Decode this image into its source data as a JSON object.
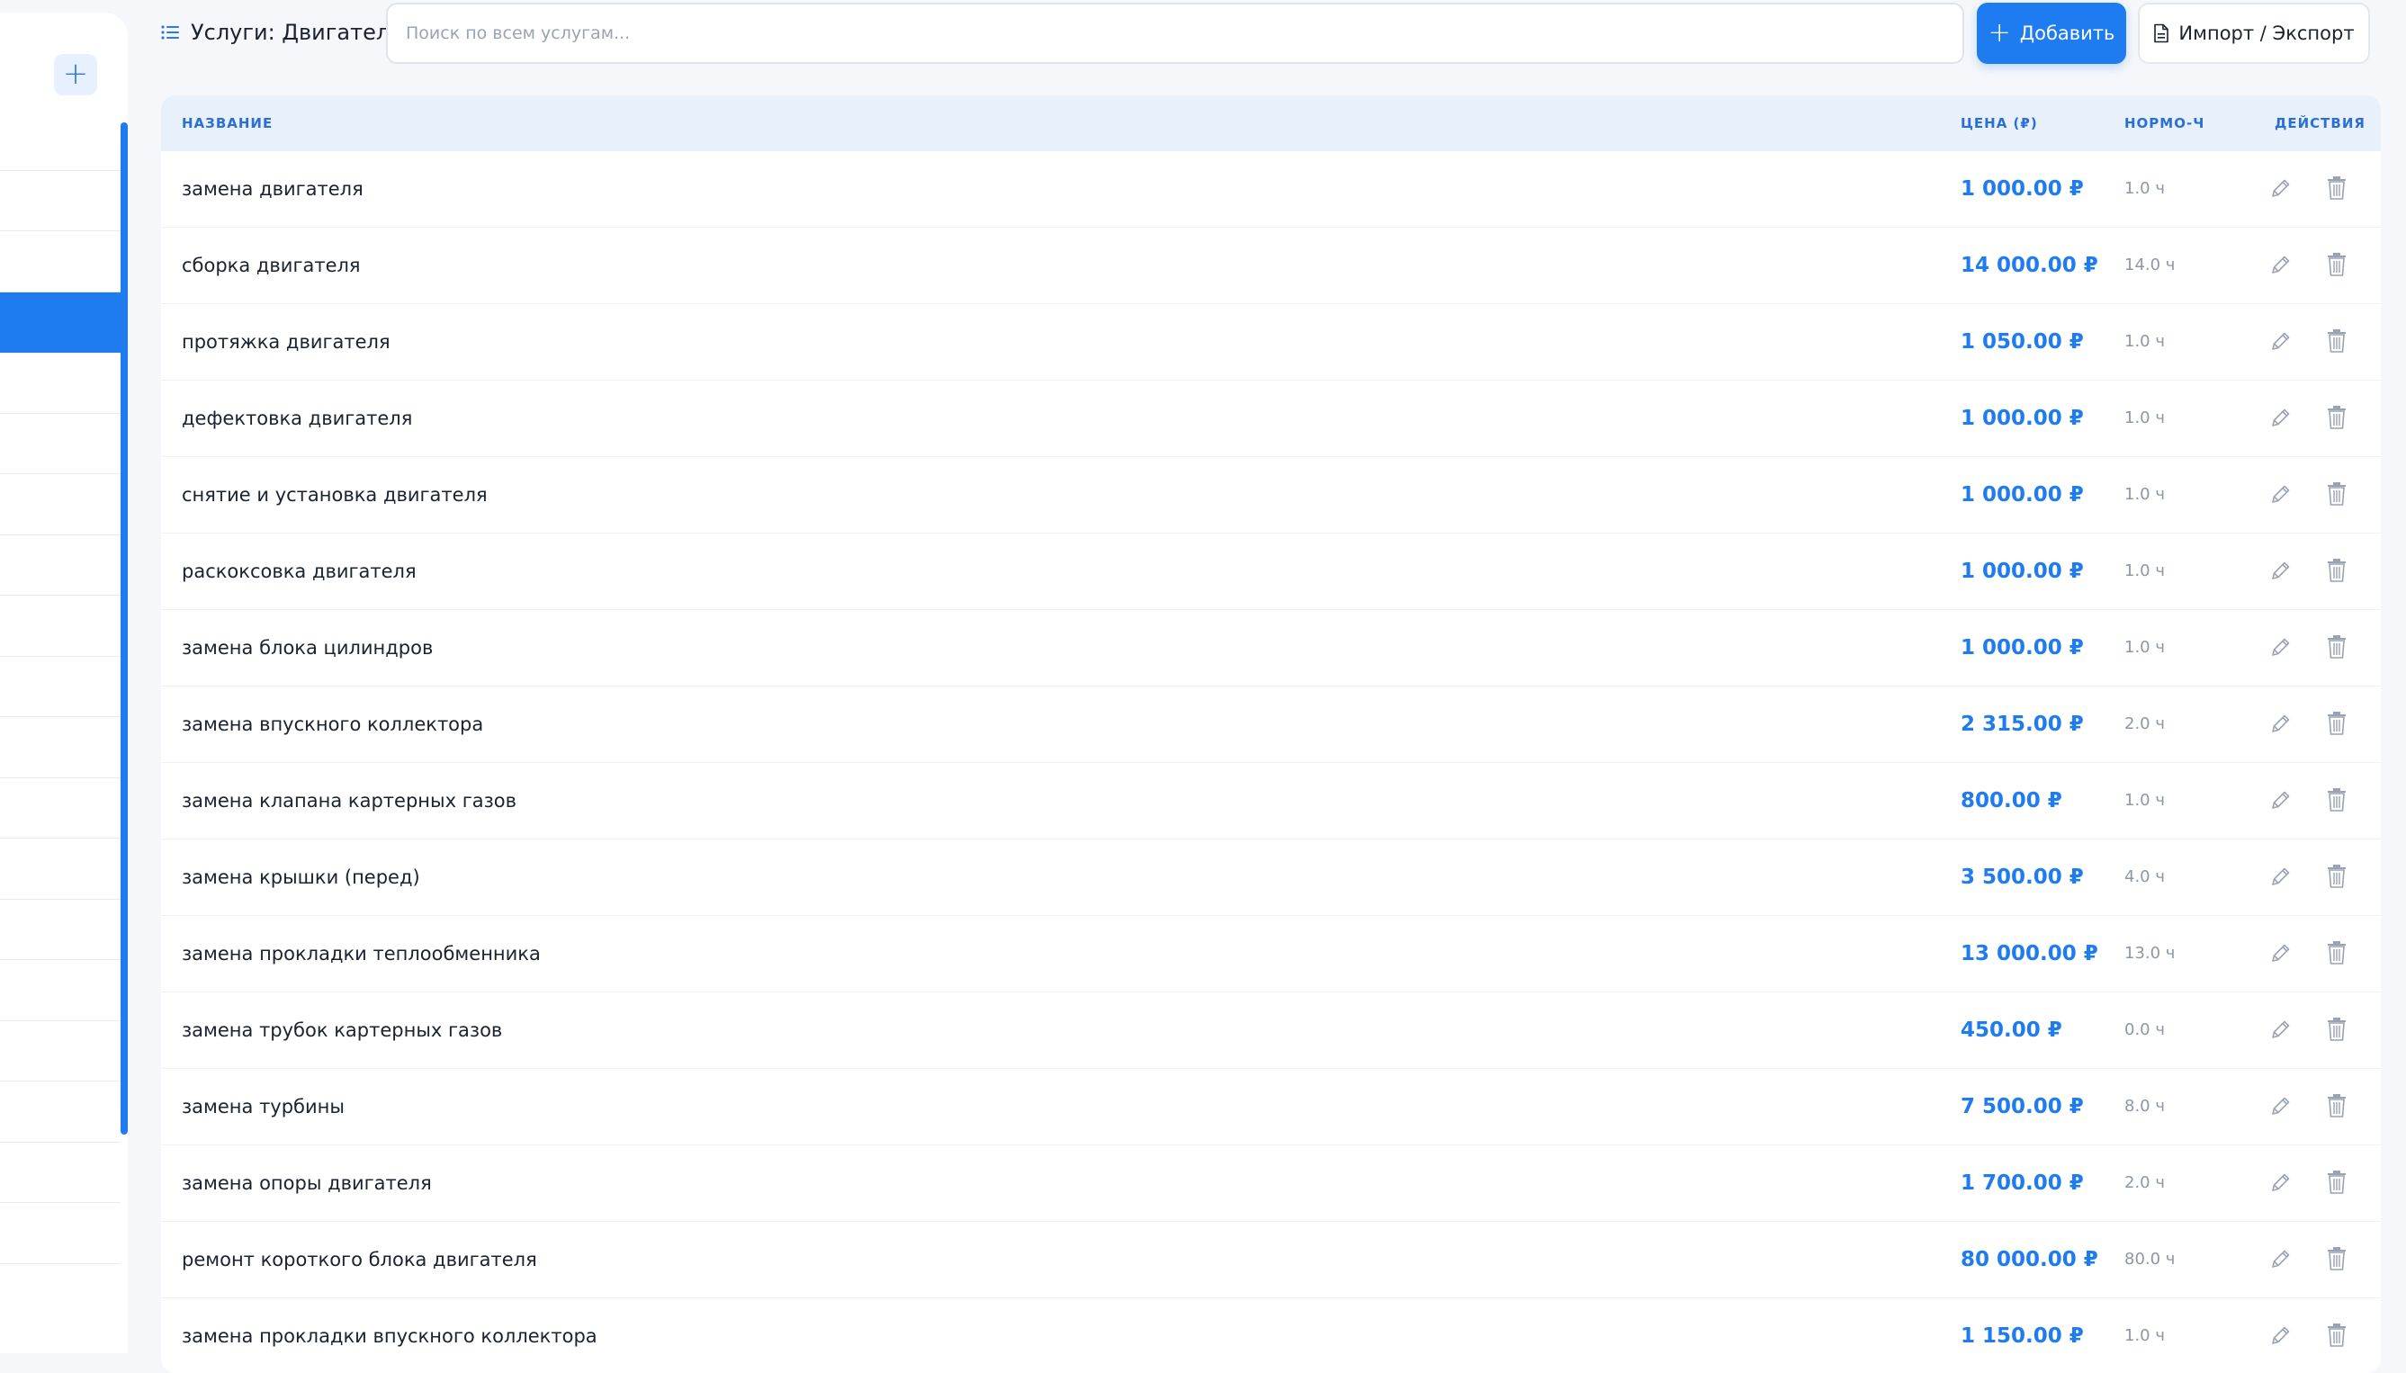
{
  "header": {
    "title": "Услуги: Двигатель",
    "search_placeholder": "Поиск по всем услугам...",
    "add_label": "Добавить",
    "import_label": "Импорт / Экспорт"
  },
  "sidebar": {
    "add_symbol": "+",
    "item_count": 19,
    "active_index": 3
  },
  "table": {
    "columns": {
      "name": "НАЗВАНИЕ",
      "price": "ЦЕНА (₽)",
      "hours": "НОРМО-Ч",
      "actions": "ДЕЙСТВИЯ"
    },
    "rows": [
      {
        "name": "замена двигателя",
        "price": "1 000.00 ₽",
        "hours": "1.0 ч"
      },
      {
        "name": "сборка двигателя",
        "price": "14 000.00 ₽",
        "hours": "14.0 ч"
      },
      {
        "name": "протяжка двигателя",
        "price": "1 050.00 ₽",
        "hours": "1.0 ч"
      },
      {
        "name": "дефектовка двигателя",
        "price": "1 000.00 ₽",
        "hours": "1.0 ч"
      },
      {
        "name": "снятие и установка двигателя",
        "price": "1 000.00 ₽",
        "hours": "1.0 ч"
      },
      {
        "name": "раскоксовка двигателя",
        "price": "1 000.00 ₽",
        "hours": "1.0 ч"
      },
      {
        "name": "замена блока цилиндров",
        "price": "1 000.00 ₽",
        "hours": "1.0 ч"
      },
      {
        "name": "замена впускного коллектора",
        "price": "2 315.00 ₽",
        "hours": "2.0 ч"
      },
      {
        "name": "замена клапана картерных газов",
        "price": "800.00 ₽",
        "hours": "1.0 ч"
      },
      {
        "name": "замена крышки (перед)",
        "price": "3 500.00 ₽",
        "hours": "4.0 ч"
      },
      {
        "name": "замена прокладки теплообменника",
        "price": "13 000.00 ₽",
        "hours": "13.0 ч"
      },
      {
        "name": "замена трубок картерных газов",
        "price": "450.00 ₽",
        "hours": "0.0 ч"
      },
      {
        "name": "замена турбины",
        "price": "7 500.00 ₽",
        "hours": "8.0 ч"
      },
      {
        "name": "замена опоры двигателя",
        "price": "1 700.00 ₽",
        "hours": "2.0 ч"
      },
      {
        "name": "ремонт короткого блока двигателя",
        "price": "80 000.00 ₽",
        "hours": "80.0 ч"
      },
      {
        "name": "замена прокладки впускного коллектора",
        "price": "1 150.00 ₽",
        "hours": "1.0 ч"
      }
    ]
  },
  "colors": {
    "accent": "#1f7cf0",
    "header_bg": "#e8f0fc",
    "muted": "#8d97a6"
  },
  "icons": {
    "list": "list-icon",
    "document": "document-icon",
    "edit": "pencil-icon",
    "delete": "trash-icon"
  }
}
